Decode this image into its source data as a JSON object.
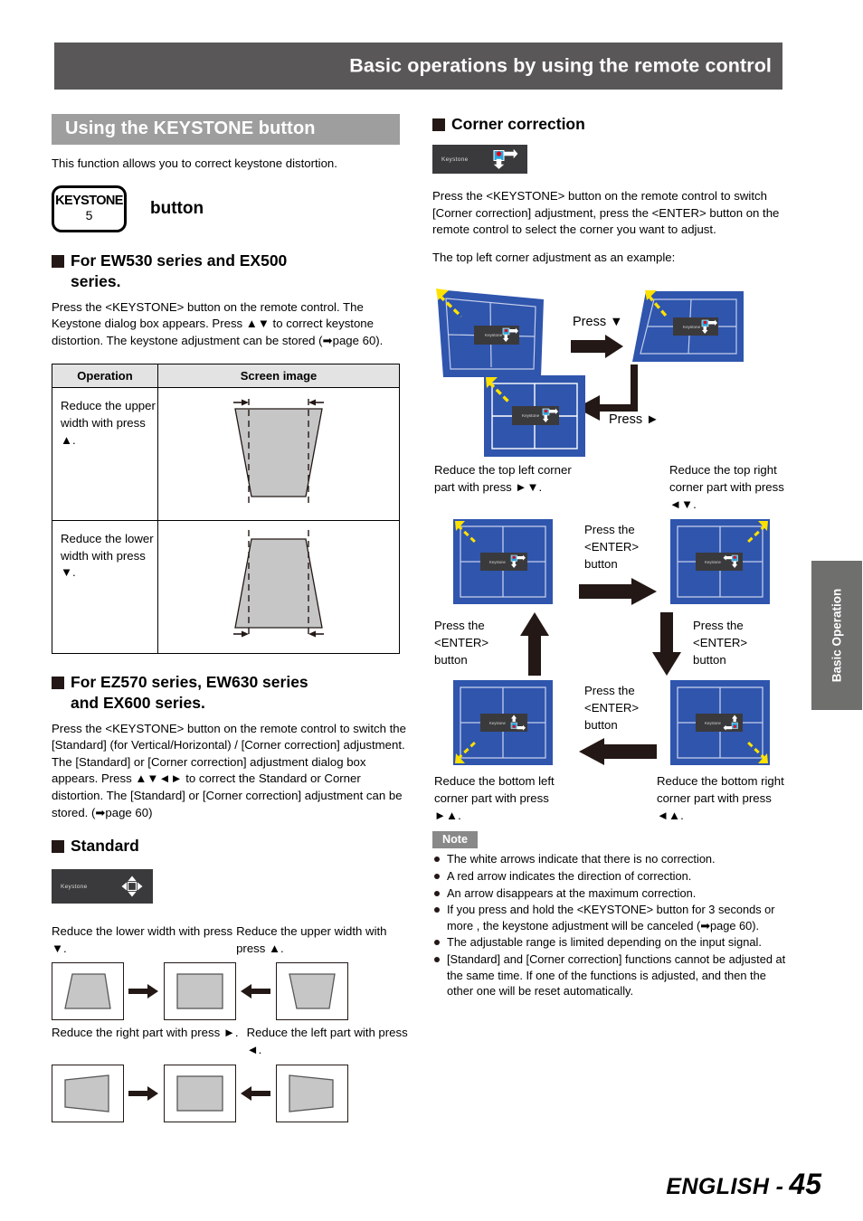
{
  "header": {
    "title": "Basic operations by using the remote control"
  },
  "side_tab": {
    "label": "Basic Operation"
  },
  "footer": {
    "language": "ENGLISH -",
    "page": "45"
  },
  "left": {
    "band_title": "Using the KEYSTONE button",
    "intro": "This function allows you to correct keystone distortion.",
    "key": {
      "line1": "KEYSTONE",
      "line2": "5",
      "label": "button"
    },
    "section1": {
      "heading_line1": "For EW530 series and EX500",
      "heading_line2": "series.",
      "body": "Press the <KEYSTONE> button on the remote control. The Keystone dialog box appears. Press ▲▼ to correct keystone distortion. The keystone adjustment can be stored (➡page 60)."
    },
    "table": {
      "headers": [
        "Operation",
        "Screen image"
      ],
      "rows": [
        {
          "operation": "Reduce the upper width with press ▲.",
          "image": "trapezoid-narrow-top"
        },
        {
          "operation": "Reduce the lower width with press ▼.",
          "image": "trapezoid-narrow-bottom"
        }
      ]
    },
    "section2": {
      "heading_line1": "For EZ570 series, EW630 series",
      "heading_line2": "and EX600 series.",
      "body": "Press the <KEYSTONE> button on the remote control to switch the [Standard] (for Vertical/Horizontal) / [Corner correction] adjustment. The [Standard] or [Corner correction] adjustment dialog box appears. Press ▲▼◄► to correct the Standard or Corner distortion. The [Standard] or [Corner correction] adjustment can be stored. (➡page 60)"
    },
    "standard": {
      "heading": "Standard",
      "osd_label": "Keystone",
      "cap_top_left": "Reduce the lower width with press ▼.",
      "cap_top_right": "Reduce the upper width with press ▲.",
      "cap_mid_left": "Reduce the right part with press ►.",
      "cap_mid_right": "Reduce the left part with press ◄."
    }
  },
  "right": {
    "heading": "Corner correction",
    "osd_label": "Keystone",
    "body1": "Press the <KEYSTONE> button on the remote control to switch [Corner correction] adjustment, press the <ENTER> button on the remote control to select the corner you want to adjust.",
    "body2": "The top left corner adjustment as an example:",
    "flow": {
      "press_down": "Press ▼",
      "press_right": "Press ►"
    },
    "corners": {
      "top_left_caption": "Reduce the top left corner part with press ►▼.",
      "top_right_caption": "Reduce the top right corner part with press ◄▼.",
      "bottom_left_caption": "Reduce the bottom left corner part with press ►▲.",
      "bottom_right_caption": "Reduce the bottom right corner part with press ◄▲.",
      "enter_label": "Press the <ENTER> button"
    },
    "note": {
      "tag": "Note",
      "items": [
        "The white arrows indicate that there is no correction.",
        "A red arrow indicates the direction of correction.",
        "An arrow disappears at the maximum correction.",
        "If you press and hold the <KEYSTONE> button for 3 seconds or more , the keystone adjustment will be canceled (➡page 60).",
        "The adjustable range is limited depending on the input signal.",
        "[Standard] and [Corner correction] functions cannot be adjusted at the same time. If one of the functions is adjusted, and then the other one will be reset automatically."
      ]
    }
  },
  "colors": {
    "header_gray": "#595757",
    "band_gray": "#9e9e9f",
    "screen_blue": "#2f55ad",
    "osd_dark": "#3a3a3c",
    "corner_yellow": "#ffe100",
    "arrow_red": "#e60012"
  }
}
